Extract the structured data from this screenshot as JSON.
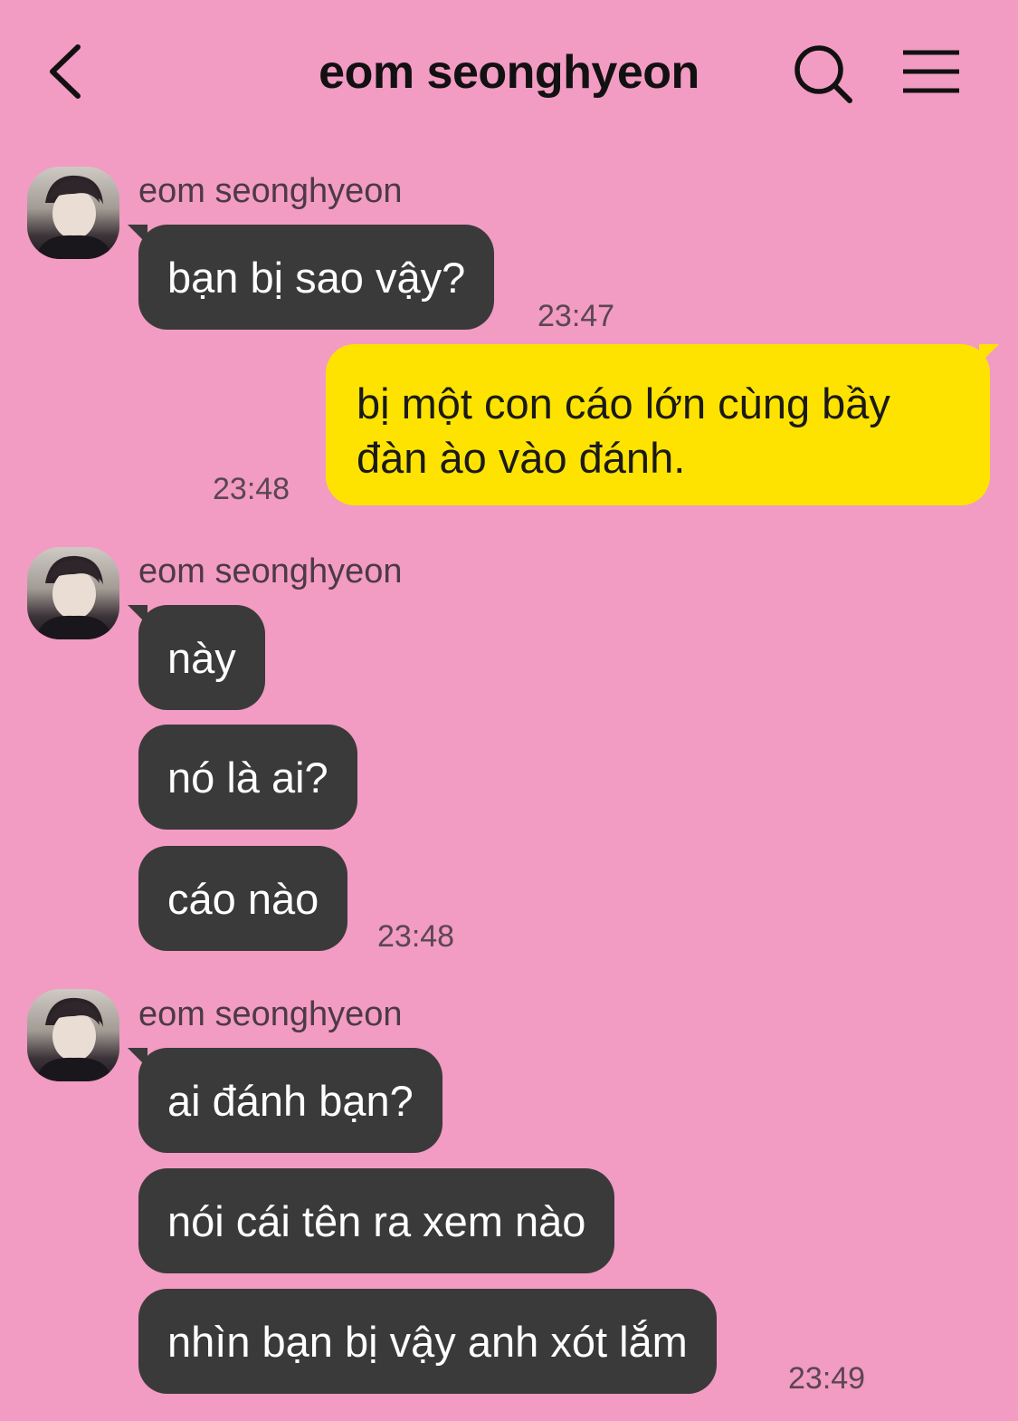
{
  "header": {
    "title": "eom seonghyeon",
    "back_icon": "chevron-left-icon",
    "search_icon": "search-icon",
    "menu_icon": "hamburger-menu-icon"
  },
  "colors": {
    "background": "#f29bc3",
    "incoming_bubble": "#3a3a3a",
    "outgoing_bubble": "#ffe300"
  },
  "messages": [
    {
      "sender": "eom seonghyeon",
      "bubbles": [
        "bạn bị sao vậy?"
      ],
      "time": "23:47"
    },
    {
      "sender": "me",
      "bubbles": [
        "bị một con cáo lớn cùng bầy đàn ào vào đánh."
      ],
      "time": "23:48"
    },
    {
      "sender": "eom seonghyeon",
      "bubbles": [
        "này",
        "nó là ai?",
        "cáo nào"
      ],
      "time": "23:48"
    },
    {
      "sender": "eom seonghyeon",
      "bubbles": [
        "ai đánh bạn?",
        "nói cái tên ra xem nào",
        "nhìn bạn bị vậy anh xót lắm"
      ],
      "time": "23:49"
    }
  ]
}
